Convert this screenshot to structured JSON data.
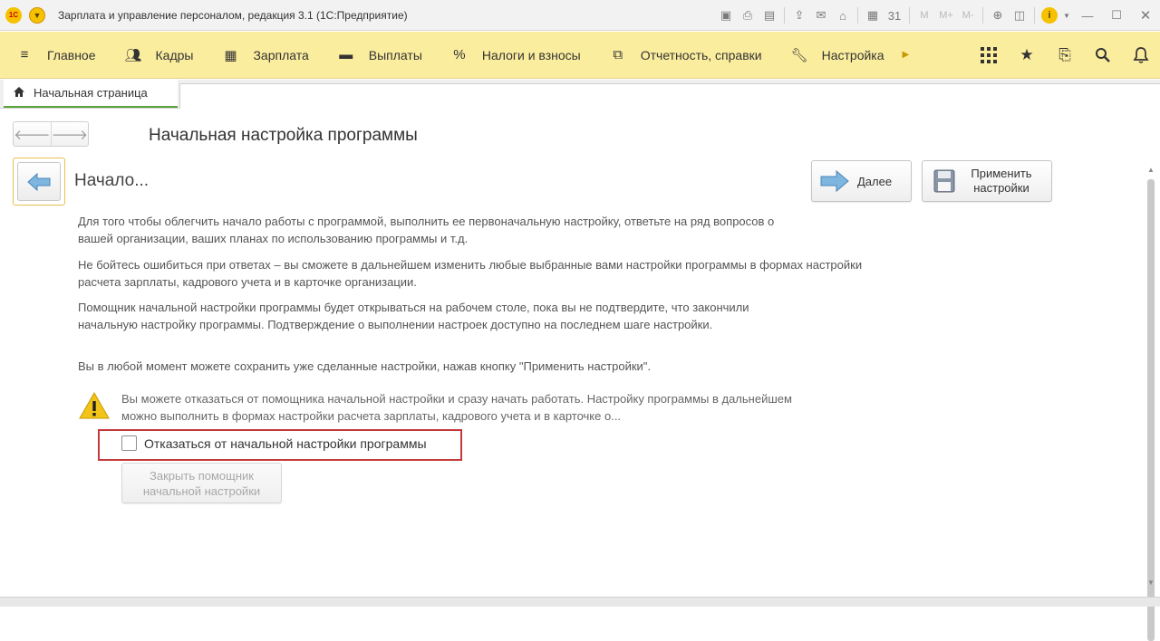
{
  "window": {
    "title": "Зарплата и управление персоналом, редакция 3.1  (1С:Предприятие)",
    "logo_text": "1С",
    "toolbar_memory": [
      "M",
      "M+",
      "M-"
    ]
  },
  "sections": {
    "items": [
      {
        "label": "Главное",
        "icon": "menu-icon"
      },
      {
        "label": "Кадры",
        "icon": "people-icon"
      },
      {
        "label": "Зарплата",
        "icon": "calculator-icon"
      },
      {
        "label": "Выплаты",
        "icon": "wallet-icon"
      },
      {
        "label": "Налоги и взносы",
        "icon": "percent-icon"
      },
      {
        "label": "Отчетность, справки",
        "icon": "documents-icon"
      },
      {
        "label": "Настройка",
        "icon": "wrench-icon"
      }
    ],
    "percent_glyph": "%"
  },
  "tabs": {
    "home": "Начальная страница"
  },
  "page": {
    "title": "Начальная настройка программы",
    "step_title": "Начало...",
    "next_label": "Далее",
    "apply_label": "Применить\nнастройки",
    "paragraphs": [
      "Для того чтобы облегчить начало работы с программой, выполнить ее первоначальную настройку, ответьте на ряд вопросов о вашей организации, ваших планах по использованию программы и т.д.",
      "Не бойтесь ошибиться при ответах – вы сможете в дальнейшем изменить любые выбранные вами настройки программы в формах настройки расчета зарплаты, кадрового учета и в карточке организации.",
      "Помощник начальной настройки программы будет открываться на рабочем столе, пока вы не подтвердите, что закончили начальную настройку программы. Подтверждение о выполнении настроек доступно на последнем шаге настройки.",
      "Вы в любой момент можете сохранить уже сделанные настройки, нажав кнопку \"Применить настройки\"."
    ],
    "warning_text": "Вы можете отказаться от помощника начальной настройки и сразу начать работать. Настройку программы в дальнейшем можно выполнить в формах настройки расчета зарплаты, кадрового учета и в карточке о...",
    "decline_checkbox_label": "Отказаться от начальной настройки программы",
    "decline_checked": false,
    "close_wizard_label": "Закрыть помощник\nначальной настройки"
  },
  "colors": {
    "section_panel": "#fbed9e",
    "active_tab_underline": "#5aa53a",
    "highlight_border": "#c33a3a",
    "warning_yellow": "#f2c318"
  }
}
